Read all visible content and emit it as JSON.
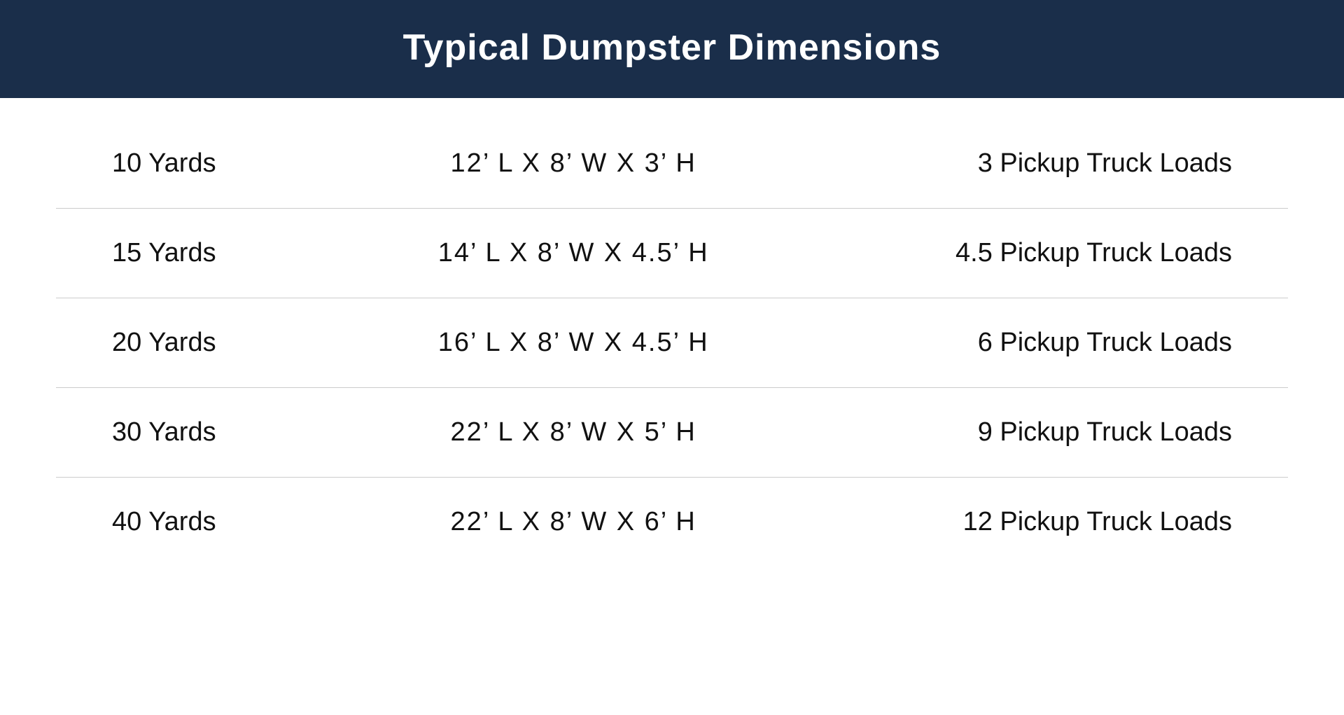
{
  "header": {
    "title": "Typical Dumpster Dimensions"
  },
  "table": {
    "rows": [
      {
        "size": "10 Yards",
        "dimensions": "12’ L  X  8’ W  X 3’ H",
        "truckLoads": "3 Pickup Truck Loads"
      },
      {
        "size": "15 Yards",
        "dimensions": "14’ L  X  8’ W  X 4.5’ H",
        "truckLoads": "4.5 Pickup Truck Loads"
      },
      {
        "size": "20 Yards",
        "dimensions": "16’ L  X  8’ W  X 4.5’ H",
        "truckLoads": "6 Pickup Truck Loads"
      },
      {
        "size": "30  Yards",
        "dimensions": "22’ L  X  8’ W  X 5’ H",
        "truckLoads": "9 Pickup Truck Loads"
      },
      {
        "size": "40 Yards",
        "dimensions": "22’ L  X  8’ W  X 6’ H",
        "truckLoads": "12 Pickup Truck Loads"
      }
    ]
  }
}
